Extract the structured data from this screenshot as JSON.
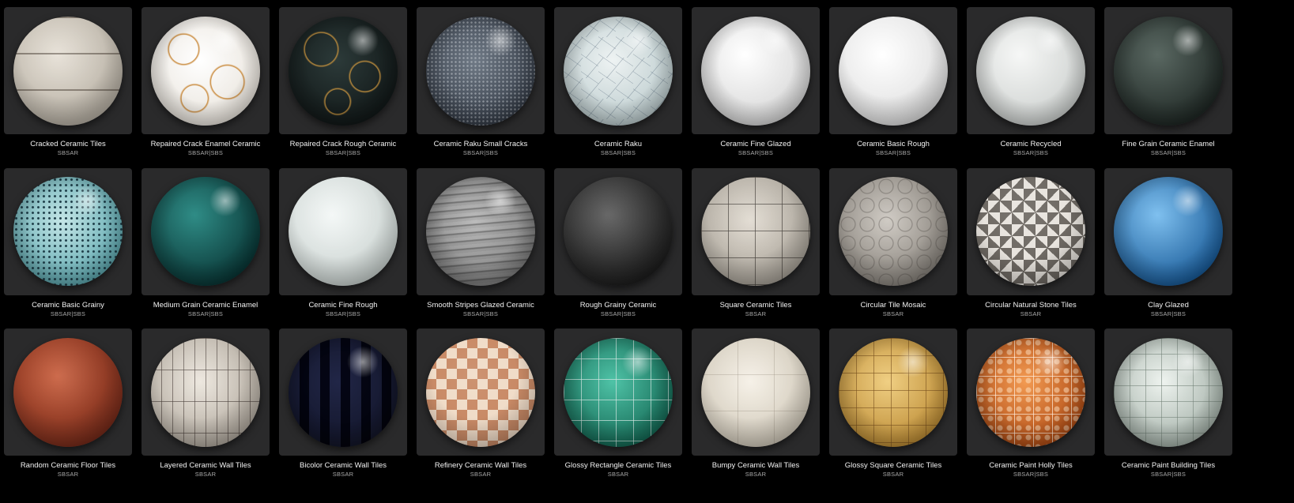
{
  "materials": [
    {
      "name": "Cracked Ceramic Tiles",
      "format": "SBSAR",
      "color": "#cdc7bd",
      "icon": "cracked-ceramic-tiles-sphere-icon"
    },
    {
      "name": "Repaired Crack Enamel Ceramic",
      "format": "SBSAR|SBS",
      "color": "#f2eee8",
      "icon": "repaired-crack-enamel-sphere-icon"
    },
    {
      "name": "Repaired Crack Rough Ceramic",
      "format": "SBSAR|SBS",
      "color": "#1e2a2a",
      "icon": "repaired-crack-rough-sphere-icon"
    },
    {
      "name": "Ceramic Raku Small Cracks",
      "format": "SBSAR|SBS",
      "color": "#4e5763",
      "icon": "raku-small-cracks-sphere-icon"
    },
    {
      "name": "Ceramic Raku",
      "format": "SBSAR|SBS",
      "color": "#cfdcdc",
      "icon": "raku-sphere-icon"
    },
    {
      "name": "Ceramic Fine Glazed",
      "format": "SBSAR|SBS",
      "color": "#e7e7e7",
      "icon": "fine-glazed-sphere-icon"
    },
    {
      "name": "Ceramic Basic Rough",
      "format": "SBSAR|SBS",
      "color": "#ececec",
      "icon": "basic-rough-sphere-icon"
    },
    {
      "name": "Ceramic Recycled",
      "format": "SBSAR|SBS",
      "color": "#dfe2e0",
      "icon": "recycled-sphere-icon"
    },
    {
      "name": "Fine Grain Ceramic Enamel",
      "format": "SBSAR|SBS",
      "color": "#2c3632",
      "icon": "fine-grain-enamel-sphere-icon"
    },
    {
      "name": "Ceramic Basic Grainy",
      "format": "SBSAR|SBS",
      "color": "#9fd0d2",
      "icon": "basic-grainy-sphere-icon"
    },
    {
      "name": "Medium Grain Ceramic Enamel",
      "format": "SBSAR|SBS",
      "color": "#0f5150",
      "icon": "medium-grain-enamel-sphere-icon"
    },
    {
      "name": "Ceramic Fine Rough",
      "format": "SBSAR|SBS",
      "color": "#dfe6e4",
      "icon": "fine-rough-sphere-icon"
    },
    {
      "name": "Smooth Stripes Glazed Ceramic",
      "format": "SBSAR|SBS",
      "color": "#d6d6d6",
      "icon": "smooth-stripes-sphere-icon"
    },
    {
      "name": "Rough Grainy Ceramic",
      "format": "SBSAR|SBS",
      "color": "#3a3a3a",
      "icon": "rough-grainy-sphere-icon"
    },
    {
      "name": "Square Ceramic Tiles",
      "format": "SBSAR",
      "color": "#c9c3b8",
      "icon": "square-tiles-sphere-icon"
    },
    {
      "name": "Circular Tile Mosaic",
      "format": "SBSAR",
      "color": "#b2ada6",
      "icon": "circular-mosaic-sphere-icon"
    },
    {
      "name": "Circular Natural Stone Tiles",
      "format": "SBSAR",
      "color": "#8a847d",
      "icon": "natural-stone-tiles-sphere-icon"
    },
    {
      "name": "Clay Glazed",
      "format": "SBSAR|SBS",
      "color": "#2f7fc1",
      "icon": "clay-glazed-sphere-icon"
    },
    {
      "name": "Random Ceramic Floor Tiles",
      "format": "SBSAR",
      "color": "#a8462c",
      "icon": "random-floor-tiles-sphere-icon"
    },
    {
      "name": "Layered Ceramic Wall Tiles",
      "format": "SBSAR",
      "color": "#cfc8bf",
      "icon": "layered-wall-tiles-sphere-icon"
    },
    {
      "name": "Bicolor Ceramic Wall Tiles",
      "format": "SBSAR",
      "color": "#23284a",
      "icon": "bicolor-wall-tiles-sphere-icon"
    },
    {
      "name": "Refinery Ceramic Wall Tiles",
      "format": "SBSAR",
      "color": "#d9a98a",
      "icon": "refinery-wall-tiles-sphere-icon"
    },
    {
      "name": "Glossy Rectangle Ceramic Tiles",
      "format": "SBSAR",
      "color": "#1e8a72",
      "icon": "glossy-rectangle-tiles-sphere-icon"
    },
    {
      "name": "Bumpy Ceramic Wall Tiles",
      "format": "SBSAR",
      "color": "#e4ddd0",
      "icon": "bumpy-wall-tiles-sphere-icon"
    },
    {
      "name": "Glossy Square Ceramic Tiles",
      "format": "SBSAR",
      "color": "#d8a94a",
      "icon": "glossy-square-tiles-sphere-icon"
    },
    {
      "name": "Ceramic Paint Holly Tiles",
      "format": "SBSAR|SBS",
      "color": "#d9661e",
      "icon": "paint-holly-tiles-sphere-icon"
    },
    {
      "name": "Ceramic Paint Building Tiles",
      "format": "SBSAR|SBS",
      "color": "#c6d0c9",
      "icon": "paint-building-tiles-sphere-icon"
    }
  ]
}
